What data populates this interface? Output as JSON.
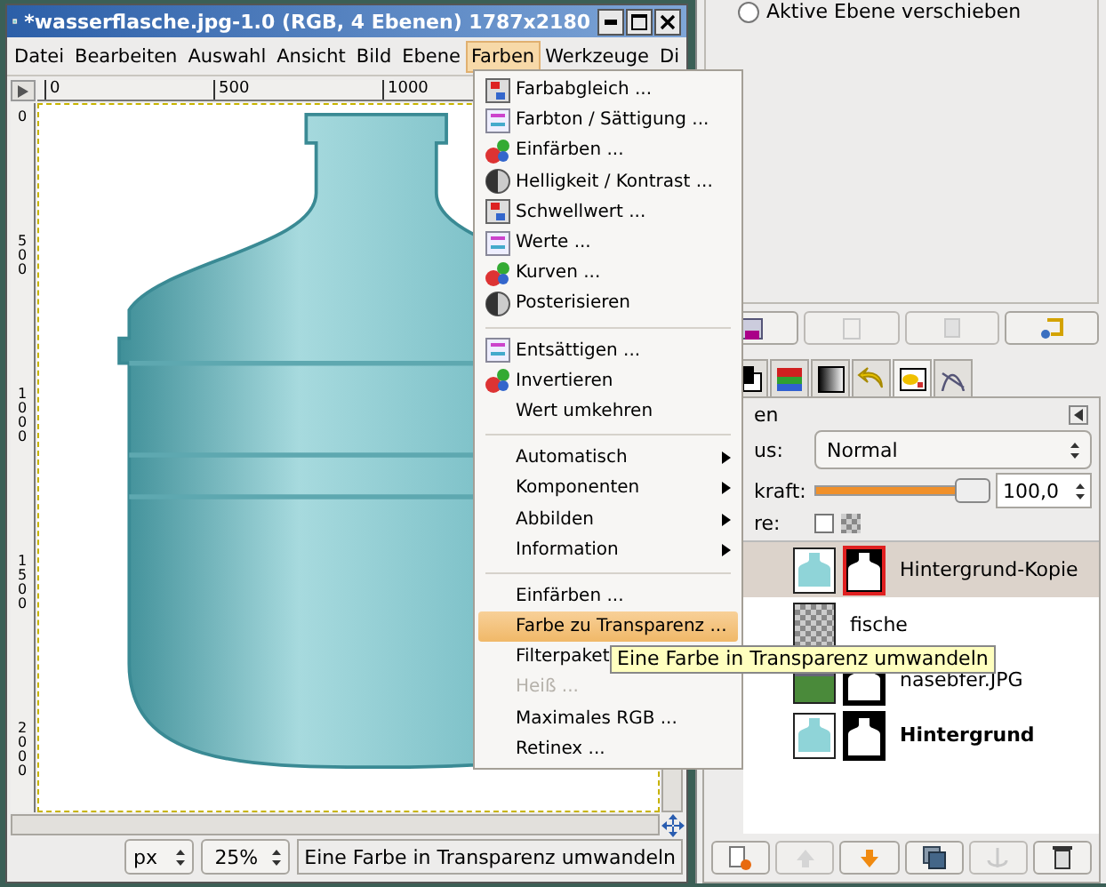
{
  "window": {
    "title": "*wasserflasche.jpg-1.0 (RGB, 4 Ebenen) 1787x2180"
  },
  "menubar": [
    {
      "label": "Datei",
      "selected": false
    },
    {
      "label": "Bearbeiten",
      "selected": false
    },
    {
      "label": "Auswahl",
      "selected": false
    },
    {
      "label": "Ansicht",
      "selected": false
    },
    {
      "label": "Bild",
      "selected": false
    },
    {
      "label": "Ebene",
      "selected": false
    },
    {
      "label": "Farben",
      "selected": true
    },
    {
      "label": "Werkzeuge",
      "selected": false
    },
    {
      "label": "Di",
      "selected": false
    }
  ],
  "rulers": {
    "horizontal": [
      "0",
      "500",
      "1000"
    ],
    "vertical": [
      "0",
      "500",
      "1000",
      "1500",
      "2000"
    ]
  },
  "status_bar": {
    "unit": "px",
    "zoom": "25%",
    "message": "Eine Farbe in Transparenz umwandeln"
  },
  "menu": {
    "items": [
      {
        "kind": "item",
        "label": "Farbabgleich ...",
        "icon": true,
        "submenu": false,
        "disabled": false,
        "selected": false
      },
      {
        "kind": "item",
        "label": "Farbton / Sättigung ...",
        "icon": true,
        "submenu": false,
        "disabled": false,
        "selected": false
      },
      {
        "kind": "item",
        "label": "Einfärben ...",
        "icon": true,
        "submenu": false,
        "disabled": false,
        "selected": false
      },
      {
        "kind": "item",
        "label": "Helligkeit / Kontrast ...",
        "icon": true,
        "submenu": false,
        "disabled": false,
        "selected": false
      },
      {
        "kind": "item",
        "label": "Schwellwert ...",
        "icon": true,
        "submenu": false,
        "disabled": false,
        "selected": false
      },
      {
        "kind": "item",
        "label": "Werte ...",
        "icon": true,
        "submenu": false,
        "disabled": false,
        "selected": false
      },
      {
        "kind": "item",
        "label": "Kurven ...",
        "icon": true,
        "submenu": false,
        "disabled": false,
        "selected": false
      },
      {
        "kind": "item",
        "label": "Posterisieren",
        "icon": true,
        "submenu": false,
        "disabled": false,
        "selected": false
      },
      {
        "kind": "separator"
      },
      {
        "kind": "item",
        "label": "Entsättigen ...",
        "icon": true,
        "submenu": false,
        "disabled": false,
        "selected": false
      },
      {
        "kind": "item",
        "label": "Invertieren",
        "icon": true,
        "submenu": false,
        "disabled": false,
        "selected": false
      },
      {
        "kind": "item",
        "label": "Wert umkehren",
        "icon": false,
        "submenu": false,
        "disabled": false,
        "selected": false
      },
      {
        "kind": "separator"
      },
      {
        "kind": "item",
        "label": "Automatisch",
        "icon": false,
        "submenu": true,
        "disabled": false,
        "selected": false
      },
      {
        "kind": "item",
        "label": "Komponenten",
        "icon": false,
        "submenu": true,
        "disabled": false,
        "selected": false
      },
      {
        "kind": "item",
        "label": "Abbilden",
        "icon": false,
        "submenu": true,
        "disabled": false,
        "selected": false
      },
      {
        "kind": "item",
        "label": "Information",
        "icon": false,
        "submenu": true,
        "disabled": false,
        "selected": false
      },
      {
        "kind": "separator"
      },
      {
        "kind": "item",
        "label": "Einfärben ...",
        "icon": false,
        "submenu": false,
        "disabled": false,
        "selected": false
      },
      {
        "kind": "item",
        "label": "Farbe zu Transparenz ...",
        "icon": false,
        "submenu": false,
        "disabled": false,
        "selected": true
      },
      {
        "kind": "item",
        "label": "Filterpaket",
        "icon": false,
        "disabled": false,
        "selected": false
      },
      {
        "kind": "item",
        "label": "Heiß ...",
        "icon": false,
        "submenu": false,
        "disabled": true,
        "selected": false
      },
      {
        "kind": "item",
        "label": "Maximales RGB ...",
        "icon": false,
        "submenu": false,
        "disabled": false,
        "selected": false
      },
      {
        "kind": "item",
        "label": "Retinex ...",
        "icon": false,
        "submenu": false,
        "disabled": false,
        "selected": false
      }
    ]
  },
  "tooltip": "Eine Farbe in Transparenz umwandeln",
  "dock": {
    "tool_option": {
      "label": "Aktive Ebene verschieben",
      "selected": false
    },
    "layers": {
      "title": "en",
      "mode_label": "us:",
      "mode": "Normal",
      "opacity_label": "kraft:",
      "opacity": {
        "level": 1,
        "reading": "100,0"
      },
      "lock_label": "re:",
      "lock_pixels": false,
      "items": [
        {
          "name": "Hintergrund-Kopie",
          "kind": "bottle",
          "mask": true,
          "mask_active": true,
          "bold": false,
          "selected": true
        },
        {
          "name": "fische",
          "kind": "transparent",
          "mask": false,
          "bold": false,
          "selected": false
        },
        {
          "name": "nasebfer.JPG",
          "kind": "photo",
          "mask": true,
          "mask_active": false,
          "bold": false,
          "selected": false
        },
        {
          "name": "Hintergrund",
          "kind": "bottle",
          "mask": true,
          "mask_active": false,
          "bold": true,
          "selected": false
        }
      ]
    }
  }
}
